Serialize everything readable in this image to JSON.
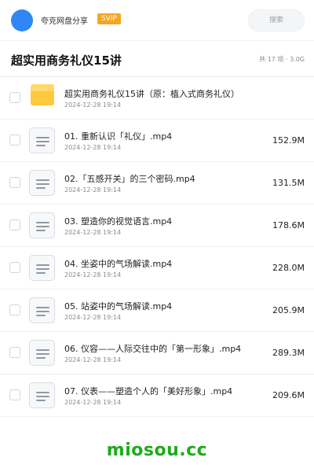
{
  "app": {
    "brand": "夸克网盘分享",
    "badge": "SVIP",
    "search_placeholder": "搜索"
  },
  "header": {
    "title": "超实用商务礼仪15讲",
    "meta": "共 17 项 · 3.0G"
  },
  "items": [
    {
      "type": "folder",
      "name": "超实用商务礼仪15讲（原：植入式商务礼仪）",
      "date": "2024-12-28 19:14",
      "size": ""
    },
    {
      "type": "file",
      "name": "01. 重新认识「礼仪」.mp4",
      "date": "2024-12-28 19:14",
      "size": "152.9M"
    },
    {
      "type": "file",
      "name": "02.「五感开关」的三个密码.mp4",
      "date": "2024-12-28 19:14",
      "size": "131.5M"
    },
    {
      "type": "file",
      "name": "03. 塑造你的视觉语言.mp4",
      "date": "2024-12-28 19:14",
      "size": "178.6M"
    },
    {
      "type": "file",
      "name": "04. 坐姿中的气场解读.mp4",
      "date": "2024-12-28 19:14",
      "size": "228.0M"
    },
    {
      "type": "file",
      "name": "05. 站姿中的气场解读.mp4",
      "date": "2024-12-28 19:14",
      "size": "205.9M"
    },
    {
      "type": "file",
      "name": "06. 仪容——人际交往中的「第一形象」.mp4",
      "date": "2024-12-28 19:14",
      "size": "289.3M"
    },
    {
      "type": "file",
      "name": "07. 仪表——塑造个人的「美好形象」.mp4",
      "date": "2024-12-28 19:14",
      "size": "209.6M"
    }
  ],
  "watermark": "miosou.cc",
  "colors": {
    "accent": "#2f86f6",
    "svip": "#f5a623",
    "folder": "#ffc83d",
    "watermark": "#1aad19"
  }
}
